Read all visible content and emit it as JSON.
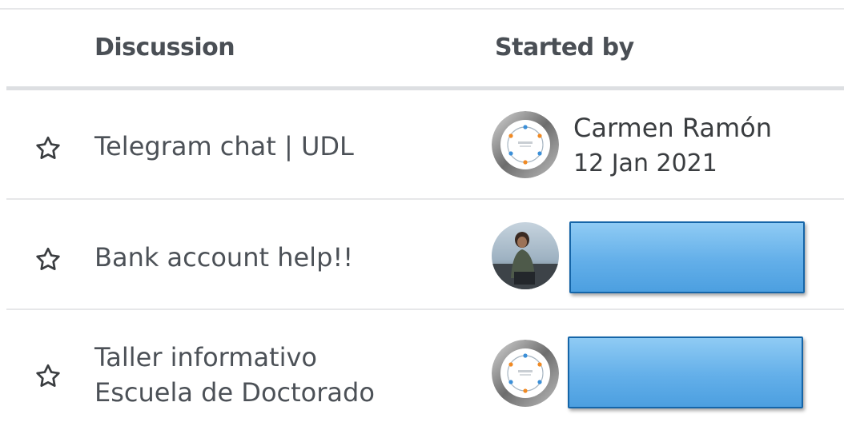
{
  "header": {
    "discussion_label": "Discussion",
    "started_by_label": "Started by"
  },
  "icons": {
    "star": "star-outline-icon",
    "avatar_logo": "circle-logo-icon"
  },
  "colors": {
    "redaction_fill": "#63afe9",
    "redaction_border": "#1565a8"
  },
  "discussions": [
    {
      "title": "Telegram chat | UDL",
      "author": "Carmen Ramón",
      "date": "12 Jan 2021",
      "avatar": "logo",
      "starred": false
    },
    {
      "title": "Bank account help!!",
      "author": "",
      "date": "",
      "avatar": "photo",
      "starred": false,
      "author_redacted": true
    },
    {
      "title_line1": "Taller informativo",
      "title_line2": "Escuela de Doctorado",
      "author": "",
      "date": "",
      "avatar": "logo",
      "starred": false,
      "author_redacted": true
    }
  ]
}
